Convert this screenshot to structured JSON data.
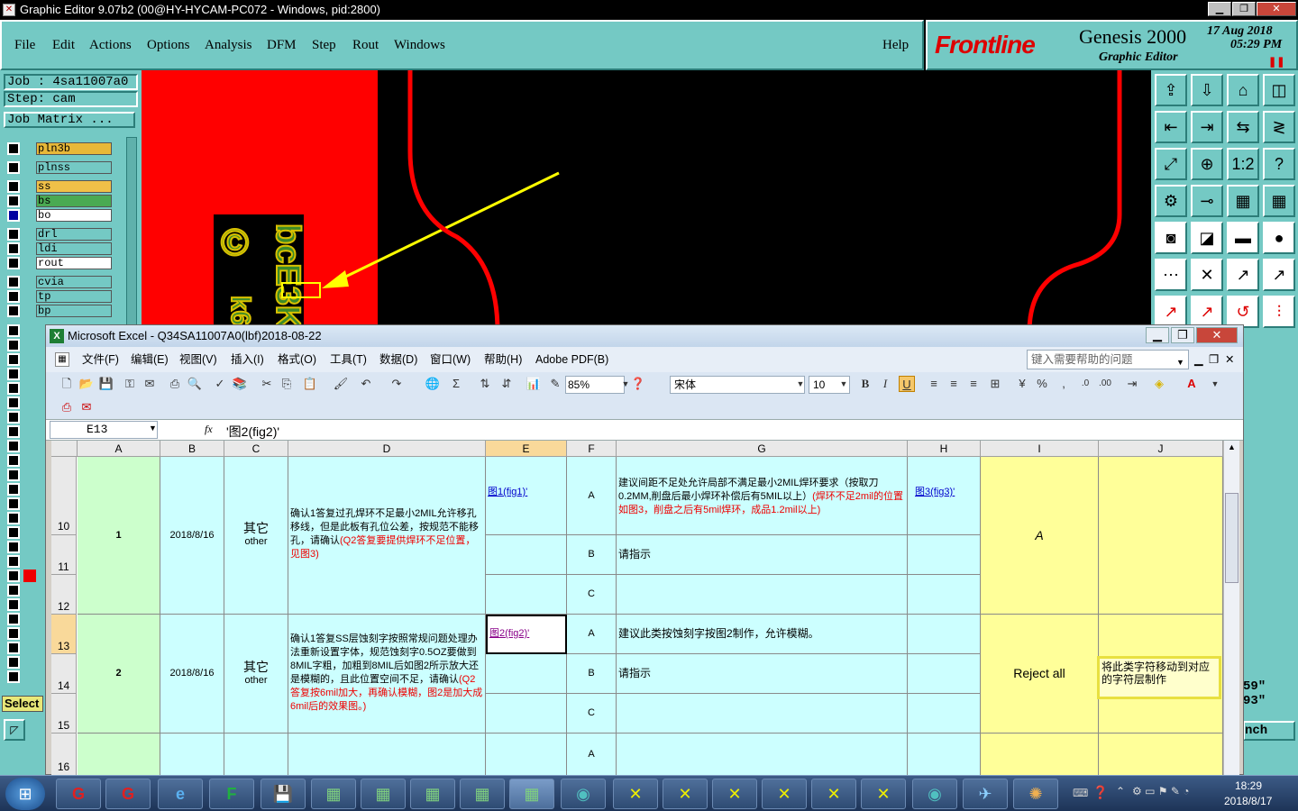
{
  "genesis": {
    "title": "Graphic Editor 9.07b2 (00@HY-HYCAM-PC072 - Windows, pid:2800)",
    "menu": [
      "File",
      "Edit",
      "Actions",
      "Options",
      "Analysis",
      "DFM",
      "Step",
      "Rout",
      "Windows"
    ],
    "help": "Help",
    "brand": "Frontline",
    "product": "Genesis 2000",
    "subtitle": "Graphic Editor",
    "date": "17 Aug 2018",
    "time": "05:29 PM",
    "job": "Job : 4sa11007a0",
    "step": "Step: cam",
    "job_matrix": "Job Matrix ...",
    "layers": [
      {
        "name": "pln3b",
        "color": "#e8b838"
      },
      {
        "name": "plnss",
        "color": "#74c9c4"
      },
      {
        "name": "ss",
        "color": "#f0c048"
      },
      {
        "name": "bs",
        "color": "#4aaa52"
      },
      {
        "name": "bo",
        "color": "#ffffff"
      },
      {
        "name": "drl",
        "color": "#74c9c4"
      },
      {
        "name": "ldi",
        "color": "#74c9c4"
      },
      {
        "name": "rout",
        "color": "#ffffff"
      },
      {
        "name": "cvia",
        "color": "#74c9c4"
      },
      {
        "name": "tp",
        "color": "#74c9c4"
      },
      {
        "name": "bp",
        "color": "#74c9c4"
      }
    ],
    "select_label": "Select",
    "right_readout1": "59\"",
    "right_readout2": "93\"",
    "right_button": "nch"
  },
  "excel": {
    "title": "Microsoft Excel - Q34SA11007A0(lbf)2018-08-22",
    "menu": [
      "文件(F)",
      "编辑(E)",
      "视图(V)",
      "插入(I)",
      "格式(O)",
      "工具(T)",
      "数据(D)",
      "窗口(W)",
      "帮助(H)",
      "Adobe PDF(B)"
    ],
    "help_placeholder": "键入需要帮助的问题",
    "zoom": "85%",
    "font": "宋体",
    "font_size": "10",
    "name_box": "E13",
    "fx": "fx",
    "formula": "'图2(fig2)'",
    "columns": [
      "A",
      "B",
      "C",
      "D",
      "E",
      "F",
      "G",
      "H",
      "I",
      "J"
    ],
    "rows": [
      "10",
      "11",
      "12",
      "13",
      "14",
      "15",
      "16"
    ],
    "r1": {
      "no": "1",
      "date": "2018/8/16",
      "cat1": "其它",
      "cat2": "other",
      "desc": "确认1答复过孔焊环不足最小2MIL允许移孔移线，但是此板有孔位公差，按规范不能移孔，请确认",
      "desc_red": "(Q2答复要提供焊环不足位置，见图3)",
      "fig1": "图1(fig1)'",
      "opt_a": "A",
      "opt_b": "B",
      "opt_c": "C",
      "g_a": "建议间距不足处允许局部不满足最小2MIL焊环要求（按取刀0.2MM,削盘后最小焊环补偿后有5MIL以上）",
      "g_a_red": "(焊环不足2mil的位置如图3，削盘之后有5mil焊环，成品1.2mil以上)",
      "g_b": "请指示",
      "fig3": "图3(fig3)'",
      "answer": "A"
    },
    "r2": {
      "no": "2",
      "date": "2018/8/16",
      "cat1": "其它",
      "cat2": "other",
      "desc": "确认1答复SS层蚀刻字按照常规问题处理办法重新设置字体，规范蚀刻字0.5OZ要做到8MIL字粗，加粗到8MIL后如图2所示放大还是模糊的，且此位置空间不足，请确认",
      "desc_red": "(Q2答复按6mil加大，再确认模糊，图2是加大成6mil后的效果图。)",
      "fig2": "图2(fig2)'",
      "opt_a": "A",
      "opt_b": "B",
      "opt_c": "C",
      "g_a": "建议此类按蚀刻字按图2制作，允许模糊。",
      "g_b": "请指示",
      "answer": "Reject all",
      "note": "将此类字符移动到对应的字符层制作"
    },
    "r3": {
      "opt_a": "A"
    }
  },
  "taskbar": {
    "time": "18:29",
    "date": "2018/8/17"
  }
}
